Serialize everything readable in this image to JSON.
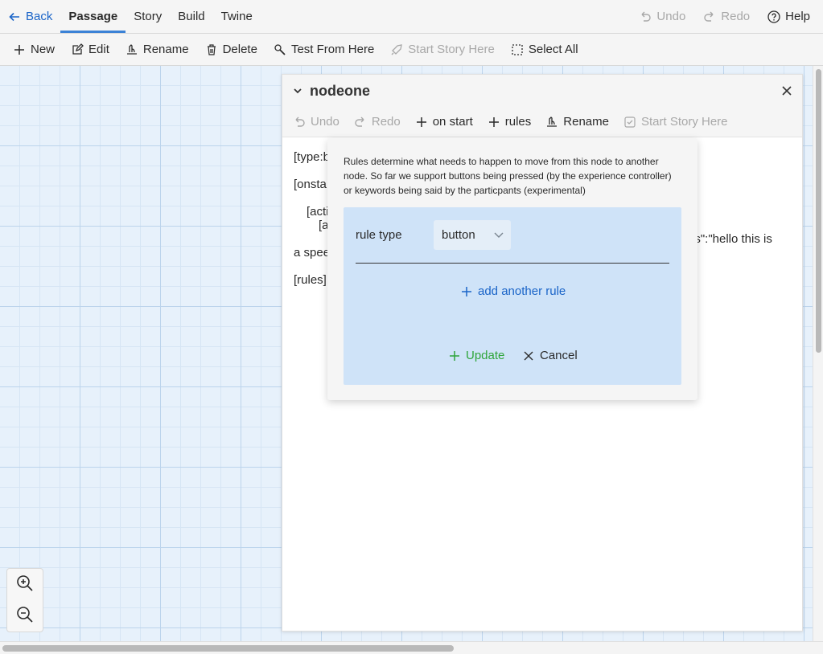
{
  "topbar": {
    "back_label": "Back",
    "tabs": [
      {
        "label": "Passage"
      },
      {
        "label": "Story"
      },
      {
        "label": "Build"
      },
      {
        "label": "Twine"
      }
    ],
    "undo_label": "Undo",
    "redo_label": "Redo",
    "help_label": "Help"
  },
  "toolbar": {
    "new_label": "New",
    "edit_label": "Edit",
    "rename_label": "Rename",
    "delete_label": "Delete",
    "test_label": "Test From Here",
    "start_label": "Start Story Here",
    "select_all_label": "Select All"
  },
  "dialog": {
    "title": "nodeone",
    "undo_label": "Undo",
    "redo_label": "Redo",
    "onstart_label": "on start",
    "rules_label": "rules",
    "rename_label": "Rename",
    "start_label": "Start Story Here",
    "lines": [
      "[type:b",
      "[onsta",
      "[acti",
      "[a",
      "ds\":\"hello this is",
      "a spee",
      "[rules]"
    ]
  },
  "popover": {
    "description": "Rules determine what needs to happen to move from this node to another node. So far we support buttons being pressed (by the experience controller) or keywords being said by the particpants (experimental)",
    "rule_type_label": "rule type",
    "rule_type_value": "button",
    "add_rule_label": "add another rule",
    "update_label": "Update",
    "cancel_label": "Cancel"
  },
  "colors": {
    "accent_blue": "#1a64c8",
    "update_green": "#2fa53a",
    "canvas_bg": "#e7f1fb",
    "rule_panel": "#cfe3f8"
  }
}
